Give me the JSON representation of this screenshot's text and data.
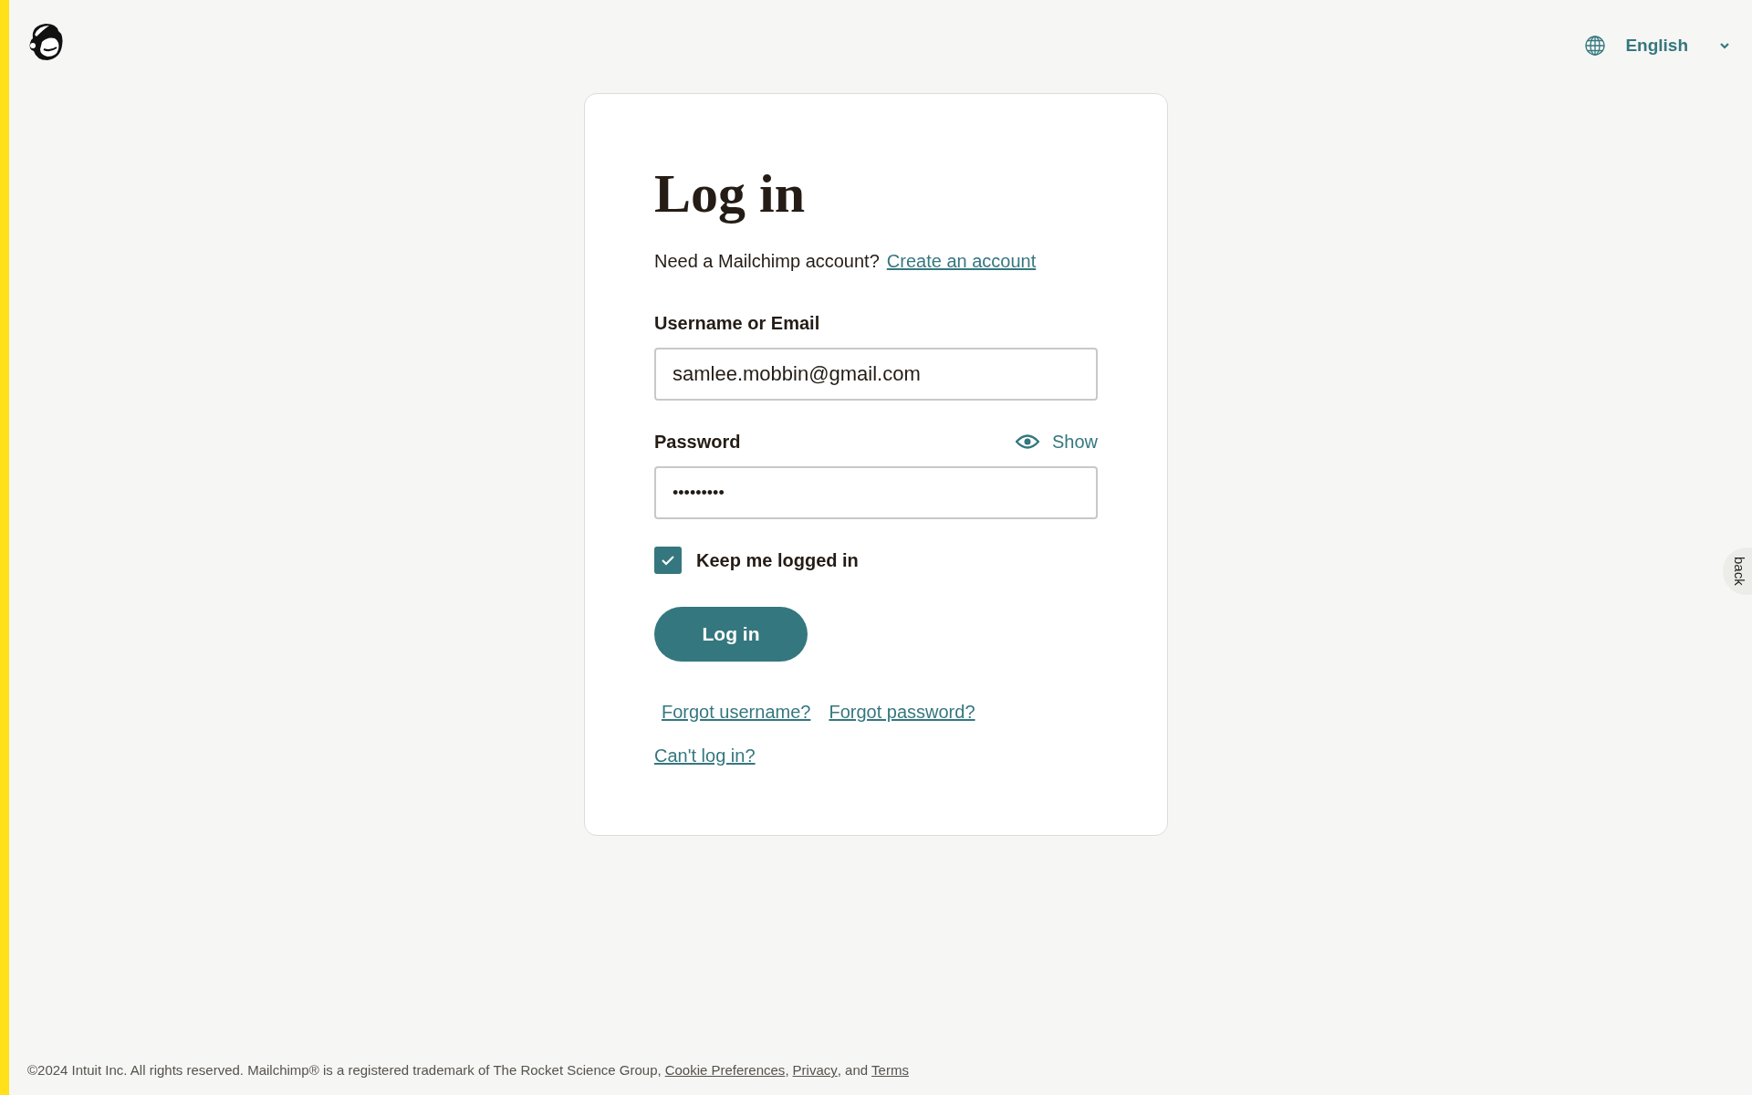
{
  "header": {
    "language": "English"
  },
  "feedback_tab": {
    "label": "back"
  },
  "login": {
    "title": "Log in",
    "signup_prompt": "Need a Mailchimp account?",
    "signup_link": "Create an account",
    "username": {
      "label": "Username or Email",
      "value": "samlee.mobbin@gmail.com"
    },
    "password": {
      "label": "Password",
      "toggle": "Show",
      "value": "•••••••••"
    },
    "keep_logged_in": {
      "label": "Keep me logged in",
      "checked": true
    },
    "submit": "Log in",
    "links": [
      "Forgot username?",
      "Forgot password?"
    ],
    "help_link": "Can't log in?"
  },
  "footer": {
    "text": "©2024 Intuit Inc. All rights reserved. Mailchimp® is a registered trademark of The Rocket Science Group,",
    "links": [
      "Cookie Preferences",
      "Privacy",
      "Terms"
    ],
    "separators": [
      ",",
      ", and"
    ]
  }
}
